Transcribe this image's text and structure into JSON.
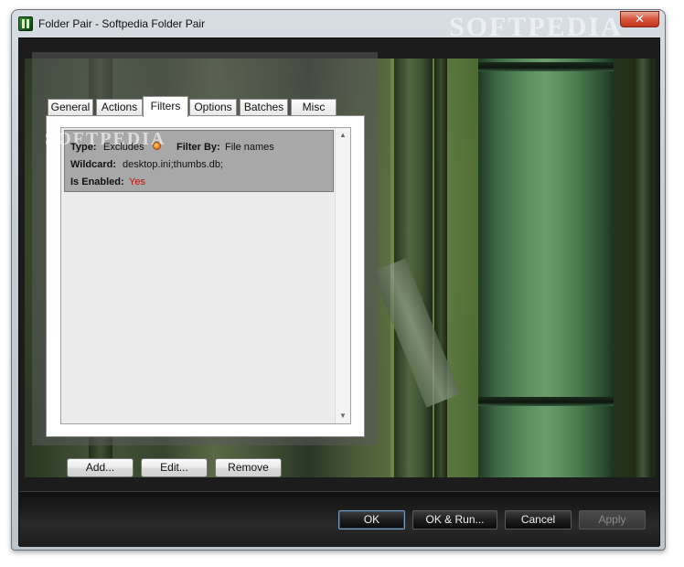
{
  "window": {
    "title": "Folder Pair - Softpedia Folder Pair",
    "watermark": "SOFTPEDIA",
    "close_glyph": "✕"
  },
  "tabs": [
    {
      "label": "General"
    },
    {
      "label": "Actions"
    },
    {
      "label": "Filters",
      "active": true
    },
    {
      "label": "Options"
    },
    {
      "label": "Batches"
    },
    {
      "label": "Misc"
    }
  ],
  "filter_item": {
    "type_label": "Type:",
    "type_value": "Excludes",
    "filter_by_label": "Filter By:",
    "filter_by_value": "File names",
    "wildcard_label": "Wildcard:",
    "wildcard_value": "desktop.ini;thumbs.db;",
    "enabled_label": "Is Enabled:",
    "enabled_value": "Yes",
    "watermark": "SOFTPEDIA",
    "enabled_color": "#c4140e",
    "type_icon": "warning-dot-icon"
  },
  "dialog_buttons": {
    "add": "Add...",
    "edit": "Edit...",
    "remove": "Remove"
  },
  "footer_buttons": {
    "ok": "OK",
    "ok_run": "OK & Run...",
    "cancel": "Cancel",
    "apply": "Apply"
  },
  "scrollbar": {
    "up_glyph": "▲",
    "down_glyph": "▼"
  },
  "colors": {
    "accent_footer_border": "#7aa0c0",
    "footer_bg": "#1c1c1c",
    "item_highlight": "#a8a8a8"
  }
}
